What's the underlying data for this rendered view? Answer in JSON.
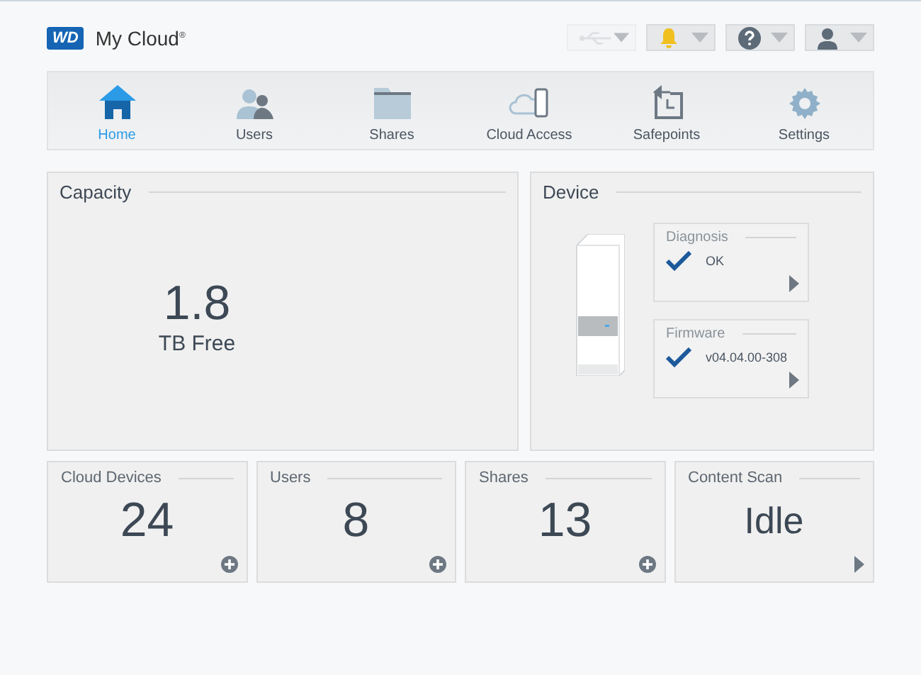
{
  "header": {
    "logo": "WD",
    "title": "My Cloud",
    "title_mark": "®",
    "menus": [
      {
        "kind": "usb",
        "disabled": true
      },
      {
        "kind": "alert",
        "disabled": false
      },
      {
        "kind": "help",
        "disabled": false
      },
      {
        "kind": "user",
        "disabled": false
      }
    ]
  },
  "nav": [
    {
      "kind": "home",
      "label": "Home",
      "selected": true
    },
    {
      "kind": "users",
      "label": "Users",
      "selected": false
    },
    {
      "kind": "shares",
      "label": "Shares",
      "selected": false
    },
    {
      "kind": "cloud",
      "label": "Cloud Access",
      "selected": false
    },
    {
      "kind": "safepoints",
      "label": "Safepoints",
      "selected": false
    },
    {
      "kind": "settings",
      "label": "Settings",
      "selected": false
    }
  ],
  "capacity": {
    "title": "Capacity",
    "value": "1.8",
    "unit": "TB Free"
  },
  "device": {
    "title": "Device",
    "cards": [
      {
        "title": "Diagnosis",
        "value": "OK"
      },
      {
        "title": "Firmware",
        "value": "v04.04.00-308"
      }
    ]
  },
  "tiles": [
    {
      "title": "Cloud Devices",
      "value": "24",
      "kind": "add"
    },
    {
      "title": "Users",
      "value": "8",
      "kind": "add"
    },
    {
      "title": "Shares",
      "value": "13",
      "kind": "add"
    },
    {
      "title": "Content Scan",
      "value": "Idle",
      "kind": "open"
    }
  ]
}
